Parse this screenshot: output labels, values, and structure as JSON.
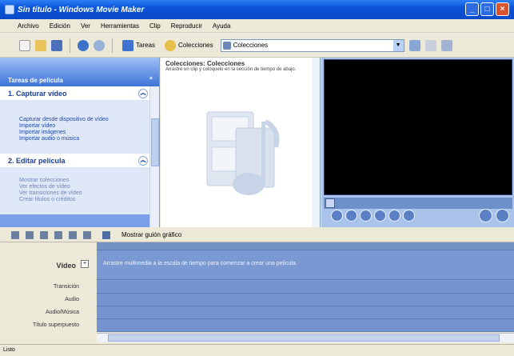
{
  "window": {
    "title": "Sin título - Windows Movie Maker"
  },
  "menu": [
    "Archivo",
    "Edición",
    "Ver",
    "Herramientas",
    "Clip",
    "Reproducir",
    "Ayuda"
  ],
  "toolbar": {
    "tasks_label": "Tareas",
    "collections_label": "Colecciones",
    "collections_combo": "Colecciones"
  },
  "taskpane": {
    "header": "Tareas de película",
    "sections": [
      {
        "title": "1. Capturar vídeo",
        "links": [
          "Capturar desde dispositivo de vídeo",
          "Importar vídeo",
          "Importar imágenes",
          "Importar audio o música"
        ]
      },
      {
        "title": "2. Editar película",
        "links": [
          "Mostrar colecciones",
          "Ver efectos de vídeo",
          "Ver transiciones de vídeo",
          "Crear títulos o créditos"
        ]
      }
    ]
  },
  "collections_pane": {
    "title": "Colecciones: Colecciones",
    "description": "Arrastre un clip y colóquelo en la sección de tiempo de abajo."
  },
  "timeline": {
    "toolbar_label": "Mostrar guión gráfico",
    "tracks": {
      "video": "Vídeo",
      "transition": "Transición",
      "audio": "Audio",
      "audio_music": "Audio/Música",
      "titles": "Título superpuesto"
    },
    "video_hint": "Arrastre multimedia a la escala de tiempo para comenzar a crear una película."
  },
  "status": {
    "text": "Listo"
  },
  "colors": {
    "titlebar": "#0b53d8",
    "taskpane": "#7a9ee8",
    "timeline_track": "#7a98d2",
    "monitor_bg": "#a9c3ea"
  }
}
